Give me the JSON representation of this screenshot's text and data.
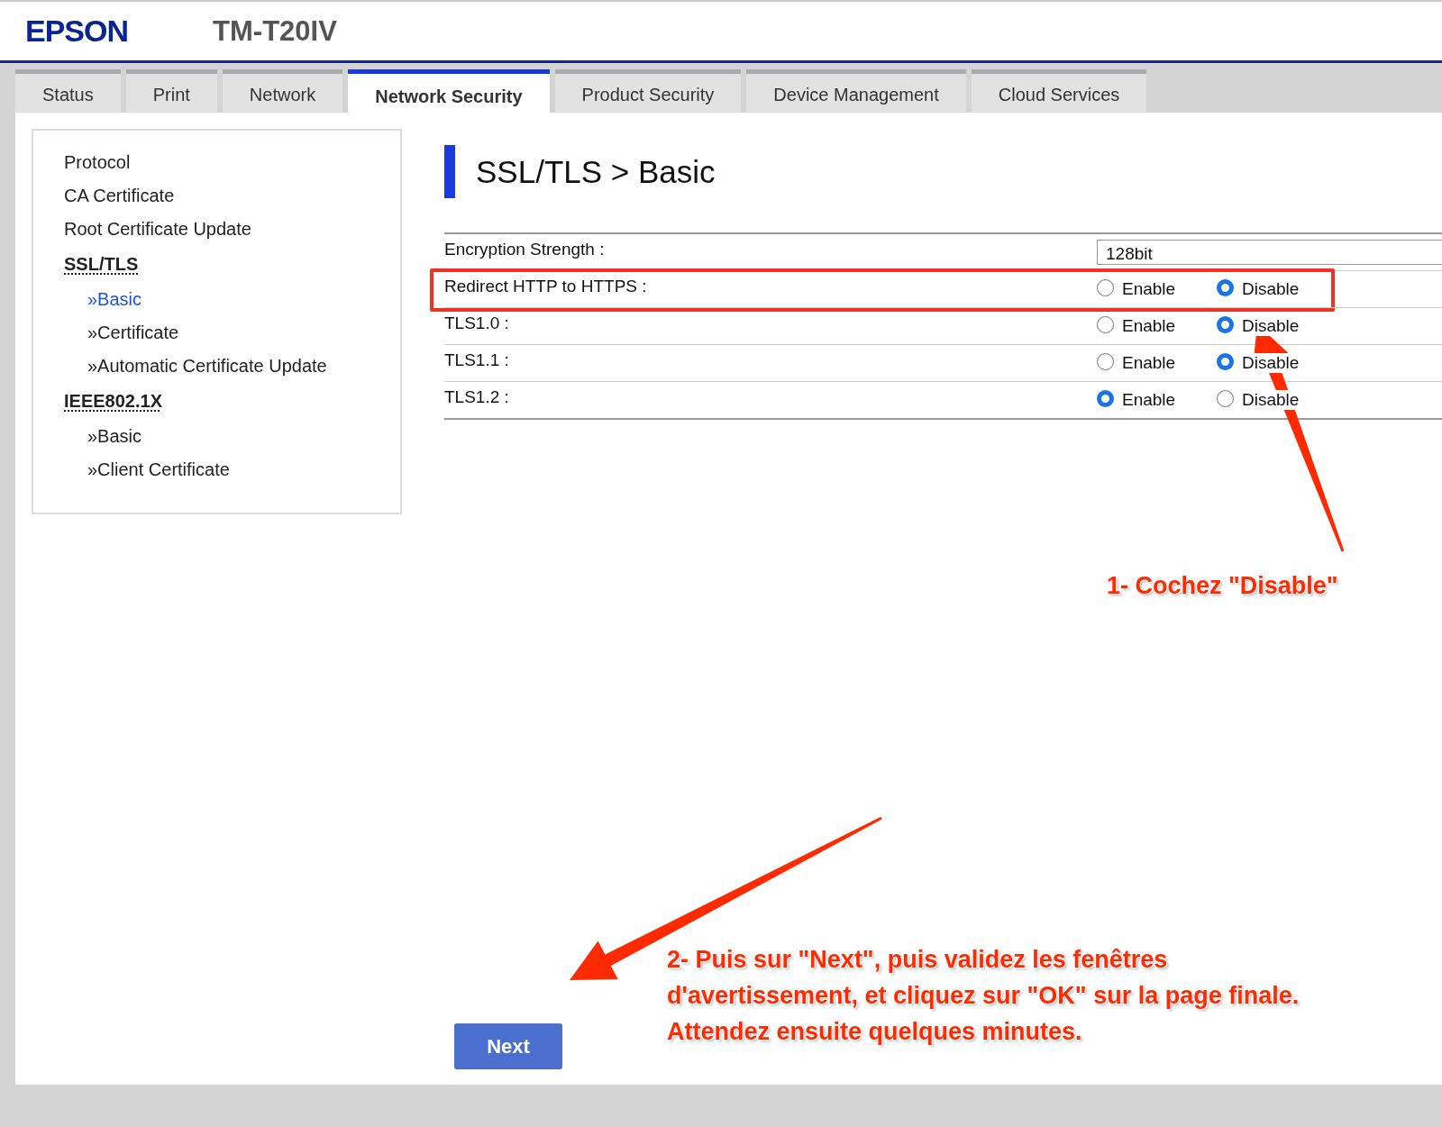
{
  "header": {
    "brand": "EPSON",
    "model": "TM-T20IV"
  },
  "tabs": [
    {
      "label": "Status",
      "selected": false
    },
    {
      "label": "Print",
      "selected": false
    },
    {
      "label": "Network",
      "selected": false
    },
    {
      "label": "Network Security",
      "selected": true
    },
    {
      "label": "Product Security",
      "selected": false
    },
    {
      "label": "Device Management",
      "selected": false
    },
    {
      "label": "Cloud Services",
      "selected": false
    }
  ],
  "sidebar": {
    "items": [
      {
        "label": "Protocol",
        "kind": "link",
        "selected": false
      },
      {
        "label": "CA Certificate",
        "kind": "link",
        "selected": false
      },
      {
        "label": "Root Certificate Update",
        "kind": "link",
        "selected": false
      },
      {
        "label": "SSL/TLS",
        "kind": "section",
        "children": [
          {
            "label": "»Basic",
            "selected": true
          },
          {
            "label": "»Certificate",
            "selected": false
          },
          {
            "label": "»Automatic Certificate Update",
            "selected": false
          }
        ]
      },
      {
        "label": "IEEE802.1X",
        "kind": "section",
        "children": [
          {
            "label": "»Basic",
            "selected": false
          },
          {
            "label": "»Client Certificate",
            "selected": false
          }
        ]
      }
    ]
  },
  "form": {
    "title": "SSL/TLS > Basic",
    "rows": [
      {
        "label": "Encryption Strength :",
        "kind": "select",
        "value": "128bit",
        "highlighted": false
      },
      {
        "label": "Redirect HTTP to HTTPS :",
        "kind": "radio",
        "highlighted": true,
        "options": [
          {
            "label": "Enable",
            "selected": false
          },
          {
            "label": "Disable",
            "selected": true
          }
        ]
      },
      {
        "label": "TLS1.0 :",
        "kind": "radio",
        "highlighted": false,
        "options": [
          {
            "label": "Enable",
            "selected": false
          },
          {
            "label": "Disable",
            "selected": true
          }
        ]
      },
      {
        "label": "TLS1.1 :",
        "kind": "radio",
        "highlighted": false,
        "options": [
          {
            "label": "Enable",
            "selected": false
          },
          {
            "label": "Disable",
            "selected": true
          }
        ]
      },
      {
        "label": "TLS1.2 :",
        "kind": "radio",
        "highlighted": false,
        "options": [
          {
            "label": "Enable",
            "selected": true
          },
          {
            "label": "Disable",
            "selected": false
          }
        ]
      }
    ],
    "next_button": "Next"
  },
  "annotations": [
    {
      "text": "1- Cochez \"Disable\""
    },
    {
      "text": "2- Puis sur \"Next\", puis validez les fenêtres\nd'avertissement, et cliquez sur \"OK\" sur la page finale.\nAttendez ensuite quelques minutes."
    }
  ]
}
